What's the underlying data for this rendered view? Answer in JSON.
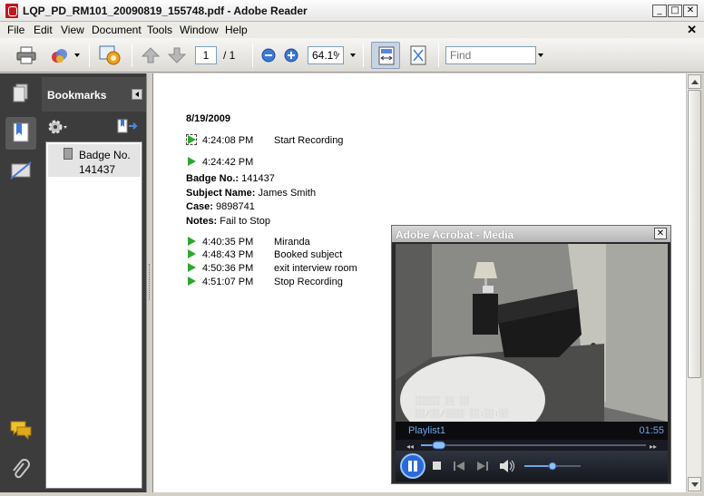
{
  "window": {
    "title": "LQP_PD_RM101_20090819_155748.pdf - Adobe Reader",
    "minimize": "_",
    "maximize": "□",
    "close": "✕"
  },
  "menu": {
    "items": [
      "File",
      "Edit",
      "View",
      "Document",
      "Tools",
      "Window",
      "Help"
    ],
    "close_doc": "✕"
  },
  "toolbar": {
    "page_current": "1",
    "page_total": "/ 1",
    "zoom": "64.1%",
    "find_placeholder": "Find"
  },
  "bookmarks": {
    "title": "Bookmarks",
    "items": [
      {
        "label": "Badge No. 141437"
      }
    ]
  },
  "document": {
    "date": "8/19/2009",
    "events_top": [
      {
        "time": "4:24:08 PM",
        "label": "Start Recording"
      },
      {
        "time": "4:24:42 PM",
        "label": ""
      }
    ],
    "fields": [
      {
        "key": "Badge No.:",
        "value": "141437"
      },
      {
        "key": "Subject Name:",
        "value": "James Smith"
      },
      {
        "key": "Case:",
        "value": "9898741"
      },
      {
        "key": "Notes:",
        "value": "Fail to Stop"
      }
    ],
    "events_bottom": [
      {
        "time": "4:40:35 PM",
        "label": "Miranda"
      },
      {
        "time": "4:48:43 PM",
        "label": "Booked subject"
      },
      {
        "time": "4:50:36 PM",
        "label": "exit interview room"
      },
      {
        "time": "4:51:07 PM",
        "label": "Stop Recording"
      }
    ]
  },
  "media": {
    "title": "Adobe Acrobat - Media",
    "close": "✕",
    "playlist": "Playlist1",
    "time": "01:55",
    "seek_position": 0.08,
    "volume": 0.5,
    "icons": [
      "pause-icon",
      "stop-icon",
      "previous-icon",
      "next-icon",
      "volume-icon"
    ]
  },
  "colors": {
    "panel_dark": "#3c3c3c",
    "marker_green": "#2ea82e",
    "media_text": "#6ea6e8"
  }
}
